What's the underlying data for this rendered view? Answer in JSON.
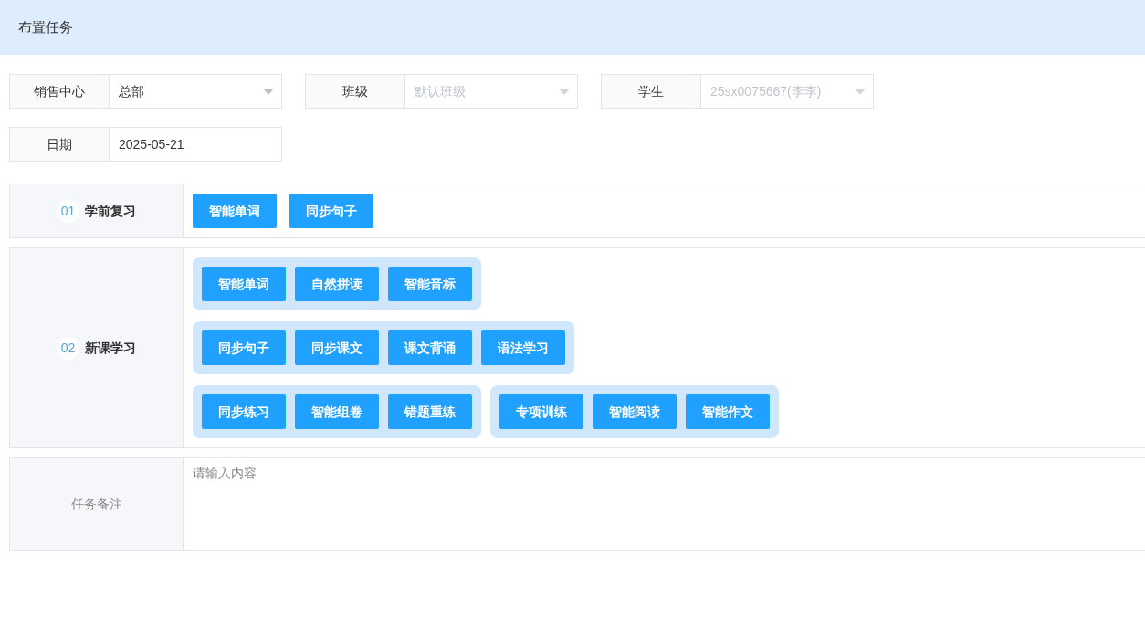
{
  "header": {
    "title": "布置任务"
  },
  "filters": [
    {
      "label": "销售中心",
      "kind": "select",
      "value": "总部",
      "disabled": false
    },
    {
      "label": "班级",
      "kind": "select",
      "placeholder": "默认班级",
      "disabled": true
    },
    {
      "label": "学生",
      "kind": "select",
      "value": "25sx0075667(李李)",
      "disabled": true
    },
    {
      "label": "日期",
      "kind": "date",
      "value": "2025-05-21",
      "disabled": false
    }
  ],
  "sections": [
    {
      "number": "01",
      "title": "学前复习",
      "groups": [
        {
          "grouped": false,
          "buttons": [
            "智能单词",
            "同步句子"
          ]
        }
      ]
    },
    {
      "number": "02",
      "title": "新课学习",
      "groups": [
        {
          "grouped": true,
          "buttons": [
            "智能单词",
            "自然拼读",
            "智能音标"
          ]
        },
        {
          "grouped": true,
          "buttons": [
            "同步句子",
            "同步课文",
            "课文背诵",
            "语法学习"
          ]
        },
        {
          "grouped": true,
          "buttons": [
            "同步练习",
            "智能组卷",
            "错题重练"
          ]
        },
        {
          "grouped": true,
          "buttons": [
            "专项训练",
            "智能阅读",
            "智能作文"
          ]
        }
      ]
    }
  ],
  "remark": {
    "label": "任务备注",
    "placeholder": "请输入内容"
  }
}
